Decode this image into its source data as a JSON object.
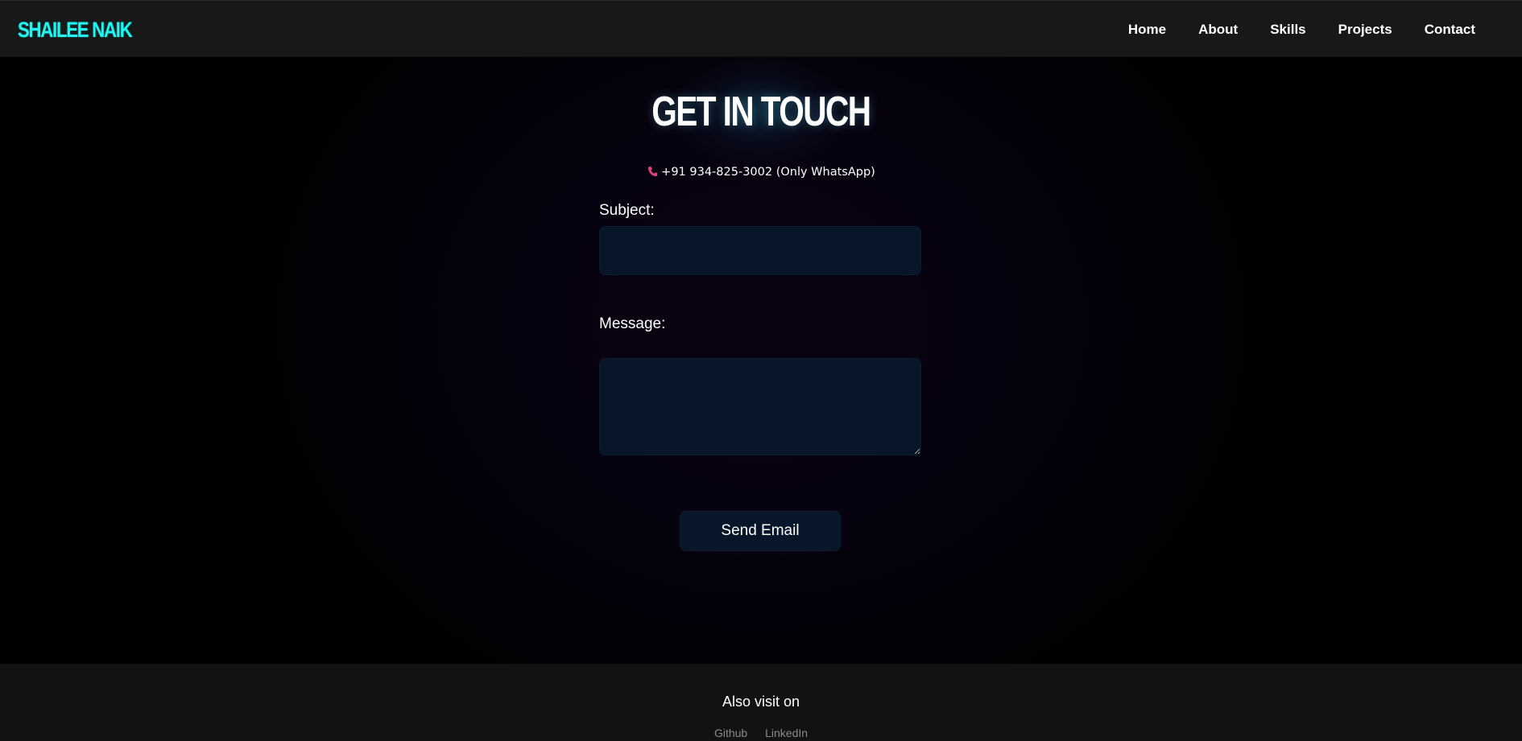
{
  "brand": {
    "name": "SHAILEE NAIK",
    "color": "#1ff6f2"
  },
  "nav": {
    "items": [
      {
        "label": "Home"
      },
      {
        "label": "About"
      },
      {
        "label": "Skills"
      },
      {
        "label": "Projects"
      },
      {
        "label": "Contact"
      }
    ]
  },
  "contact": {
    "title": "GET IN TOUCH",
    "phone": "+91 934-825-3002 (Only WhatsApp)",
    "phone_icon": "phone-icon",
    "phone_icon_color": "#e0407f",
    "subject_label": "Subject:",
    "subject_value": "",
    "message_label": "Message:",
    "message_value": "",
    "send_label": "Send Email"
  },
  "footer": {
    "heading": "Also visit on",
    "links": [
      {
        "label": "Github"
      },
      {
        "label": "LinkedIn"
      }
    ]
  },
  "colors": {
    "navbar_bg": "#181818",
    "footer_bg": "#121212",
    "field_bg": "#071628",
    "link_muted": "#8a8a8a"
  }
}
